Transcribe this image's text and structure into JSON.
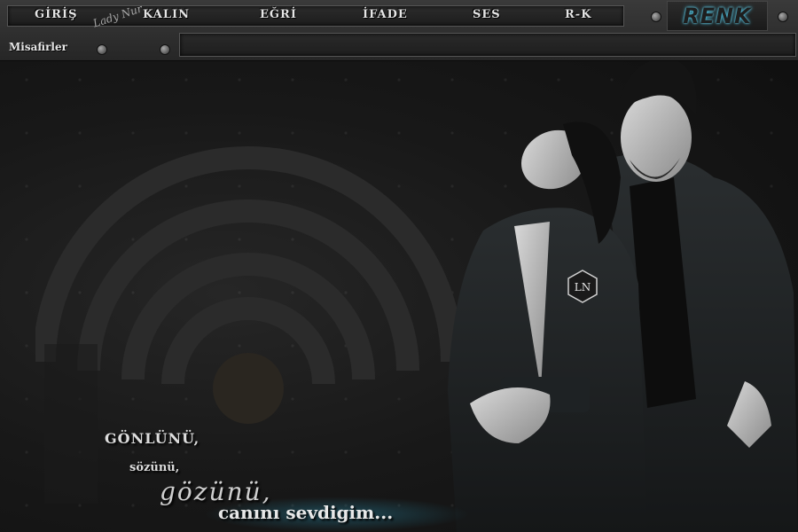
{
  "menu": {
    "items": [
      {
        "label": "GİRİŞ"
      },
      {
        "label": "KALIN"
      },
      {
        "label": "EĞRİ"
      },
      {
        "label": "İFADE"
      },
      {
        "label": "SES"
      },
      {
        "label": "R-K"
      }
    ],
    "signature": "Lady Nur",
    "color_button": "RENK"
  },
  "guests": {
    "label": "Misafirler"
  },
  "message": {
    "value": ""
  },
  "badge": {
    "text": "LN"
  },
  "watermark": {
    "line1": "GÖNLÜNÜ,",
    "line2": "sözünü,",
    "line3": "gözünü,",
    "line4": "canını sevdigim..."
  },
  "colors": {
    "accent": "#3fb7d8",
    "background": "#141414",
    "toolbar": "#2e2e2e"
  }
}
